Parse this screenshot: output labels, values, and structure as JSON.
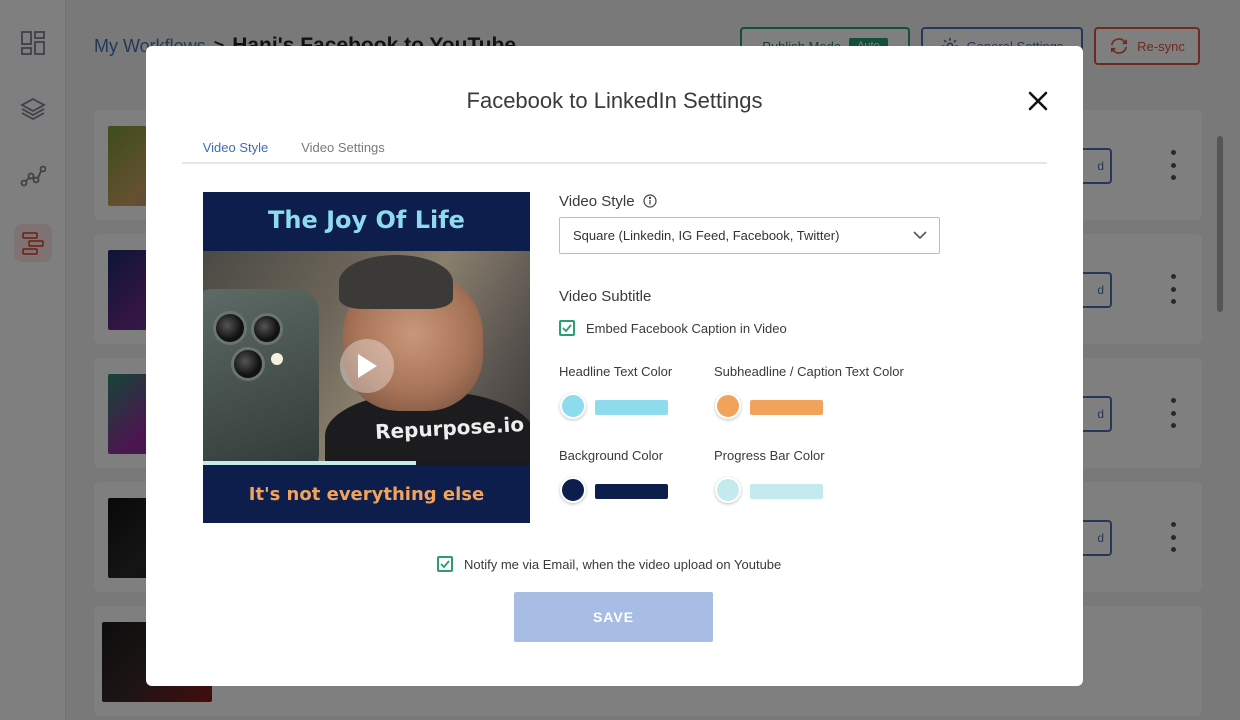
{
  "app": {
    "breadcrumb": {
      "root": "My Workflows",
      "separator": ">",
      "current": "Hani's Facebook to YouTube"
    },
    "publish_mode": {
      "label": "Publish Mode",
      "badge": "Auto"
    },
    "general_settings_label": "General Settings",
    "resync_label": "Re-sync",
    "sidebar_icons": [
      "dashboard-icon",
      "layers-icon",
      "workflow-icon",
      "sitemap-icon"
    ],
    "workflow_rows": [
      {
        "action_label": "d"
      },
      {
        "action_label": "d"
      },
      {
        "action_label": "d"
      },
      {
        "action_label": "d"
      },
      {
        "action_label": ""
      }
    ]
  },
  "modal": {
    "title": "Facebook to LinkedIn Settings",
    "tabs": [
      {
        "label": "Video Style",
        "active": true
      },
      {
        "label": "Video Settings",
        "active": false
      }
    ],
    "preview": {
      "headline": "The Joy Of Life",
      "caption": "It's not everything else",
      "shirt_text": "Repurpose.io",
      "progress": 0.65
    },
    "video_style": {
      "label": "Video Style",
      "selected": "Square (Linkedin, IG Feed, Facebook, Twitter)"
    },
    "video_subtitle": {
      "label": "Video Subtitle",
      "embed_caption": {
        "label": "Embed Facebook Caption in Video",
        "checked": true
      }
    },
    "colors": {
      "headline_text": {
        "label": "Headline Text Color",
        "value": "#8fdbee"
      },
      "subheadline_text": {
        "label": "Subheadline / Caption Text Color",
        "value": "#f2a35b"
      },
      "background": {
        "label": "Background Color",
        "value": "#0d1e4d"
      },
      "progress_bar": {
        "label": "Progress Bar Color",
        "value": "#c4eaee"
      }
    },
    "notify": {
      "label": "Notify me via Email, when the video upload on Youtube",
      "checked": true
    },
    "save_label": "SAVE"
  }
}
